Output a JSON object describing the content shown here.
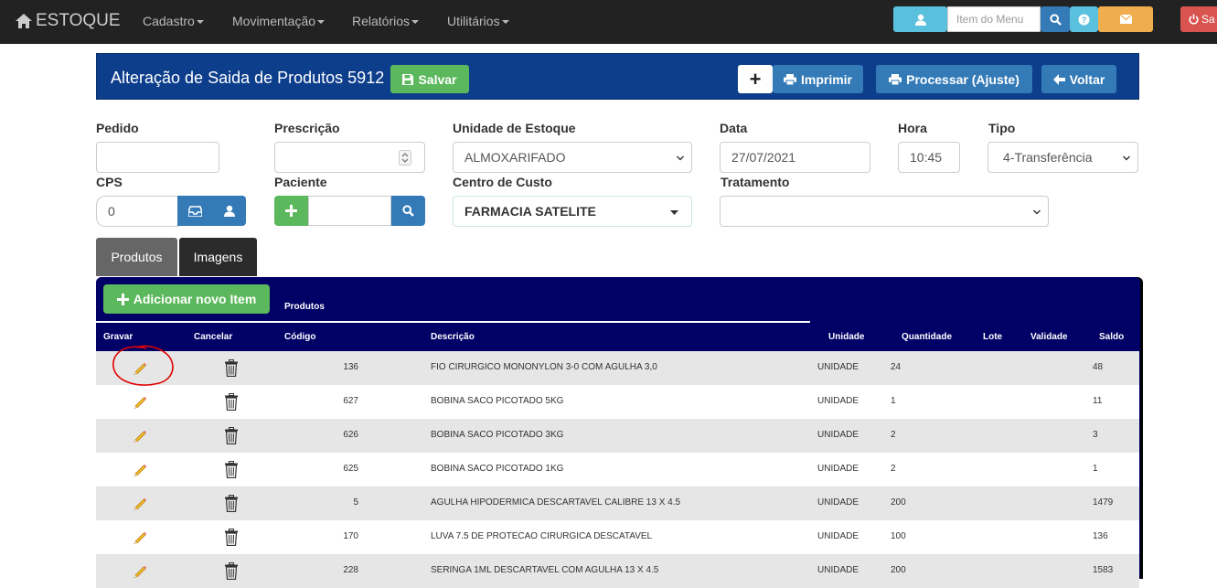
{
  "navbar": {
    "brand": "ESTOQUE",
    "menus": [
      "Cadastro",
      "Movimentação",
      "Relatórios",
      "Utilitários"
    ],
    "search_placeholder": "Item do Menu",
    "logout_label": "Sa"
  },
  "header": {
    "title": "Alteração de Saida de Produtos 5912",
    "save_label": "Salvar",
    "print_label": "Imprimir",
    "process_label": "Processar (Ajuste)",
    "back_label": "Voltar",
    "add_symbol": "+"
  },
  "form": {
    "pedido": {
      "label": "Pedido",
      "value": ""
    },
    "prescricao": {
      "label": "Prescrição",
      "value": ""
    },
    "unidade": {
      "label": "Unidade de Estoque",
      "value": "ALMOXARIFADO"
    },
    "data": {
      "label": "Data",
      "value": "27/07/2021"
    },
    "hora": {
      "label": "Hora",
      "value": "10:45"
    },
    "tipo": {
      "label": "Tipo",
      "value": "4-Transferência"
    },
    "cps": {
      "label": "CPS",
      "value": "0"
    },
    "paciente": {
      "label": "Paciente",
      "value": ""
    },
    "centro": {
      "label": "Centro de Custo",
      "value": "FARMACIA SATELITE"
    },
    "tratamento": {
      "label": "Tratamento",
      "value": ""
    }
  },
  "tabs": [
    "Produtos",
    "Imagens"
  ],
  "table": {
    "add_label": "Adicionar novo Item",
    "section_title": "Produtos",
    "headers": {
      "gravar": "Gravar",
      "cancelar": "Cancelar",
      "codigo": "Código",
      "descricao": "Descrição",
      "unidade": "Unidade",
      "quantidade": "Quantidade",
      "lote": "Lote",
      "validade": "Validade",
      "saldo": "Saldo"
    },
    "rows": [
      {
        "codigo": "136",
        "descricao": "FIO CIRURGICO MONONYLON 3-0 COM AGULHA 3,0",
        "unidade": "UNIDADE",
        "quantidade": "24",
        "lote": "",
        "validade": "",
        "saldo": "48"
      },
      {
        "codigo": "627",
        "descricao": "BOBINA SACO PICOTADO 5KG",
        "unidade": "UNIDADE",
        "quantidade": "1",
        "lote": "",
        "validade": "",
        "saldo": "11"
      },
      {
        "codigo": "626",
        "descricao": "BOBINA SACO PICOTADO 3KG",
        "unidade": "UNIDADE",
        "quantidade": "2",
        "lote": "",
        "validade": "",
        "saldo": "3"
      },
      {
        "codigo": "625",
        "descricao": "BOBINA SACO PICOTADO 1KG",
        "unidade": "UNIDADE",
        "quantidade": "2",
        "lote": "",
        "validade": "",
        "saldo": "1"
      },
      {
        "codigo": "5",
        "descricao": "AGULHA HIPODERMICA DESCARTAVEL CALIBRE 13 X 4.5",
        "unidade": "UNIDADE",
        "quantidade": "200",
        "lote": "",
        "validade": "",
        "saldo": "1479"
      },
      {
        "codigo": "170",
        "descricao": "LUVA 7.5 DE PROTECAO CIRURGICA DESCATAVEL",
        "unidade": "UNIDADE",
        "quantidade": "100",
        "lote": "",
        "validade": "",
        "saldo": "136"
      },
      {
        "codigo": "228",
        "descricao": "SERINGA 1ML DESCARTAVEL COM AGULHA 13 X 4.5",
        "unidade": "UNIDADE",
        "quantidade": "200",
        "lote": "",
        "validade": "",
        "saldo": "1583"
      }
    ]
  },
  "colors": {
    "navbar": "#222222",
    "header": "#0d3e8c",
    "table_header": "#000066",
    "success": "#5cb85c",
    "primary": "#337ab7",
    "info": "#5bc0de",
    "warning": "#f0ad4e",
    "danger": "#d9534f",
    "annotation": "#e00000"
  },
  "icons": [
    "home-icon",
    "user-icon",
    "search-icon",
    "question-icon",
    "envelope-icon",
    "power-icon",
    "save-icon",
    "plus-icon",
    "print-icon",
    "arrow-left-icon",
    "inbox-icon",
    "pencil-icon",
    "trash-icon",
    "chevron-down-icon",
    "spinner-icon"
  ]
}
